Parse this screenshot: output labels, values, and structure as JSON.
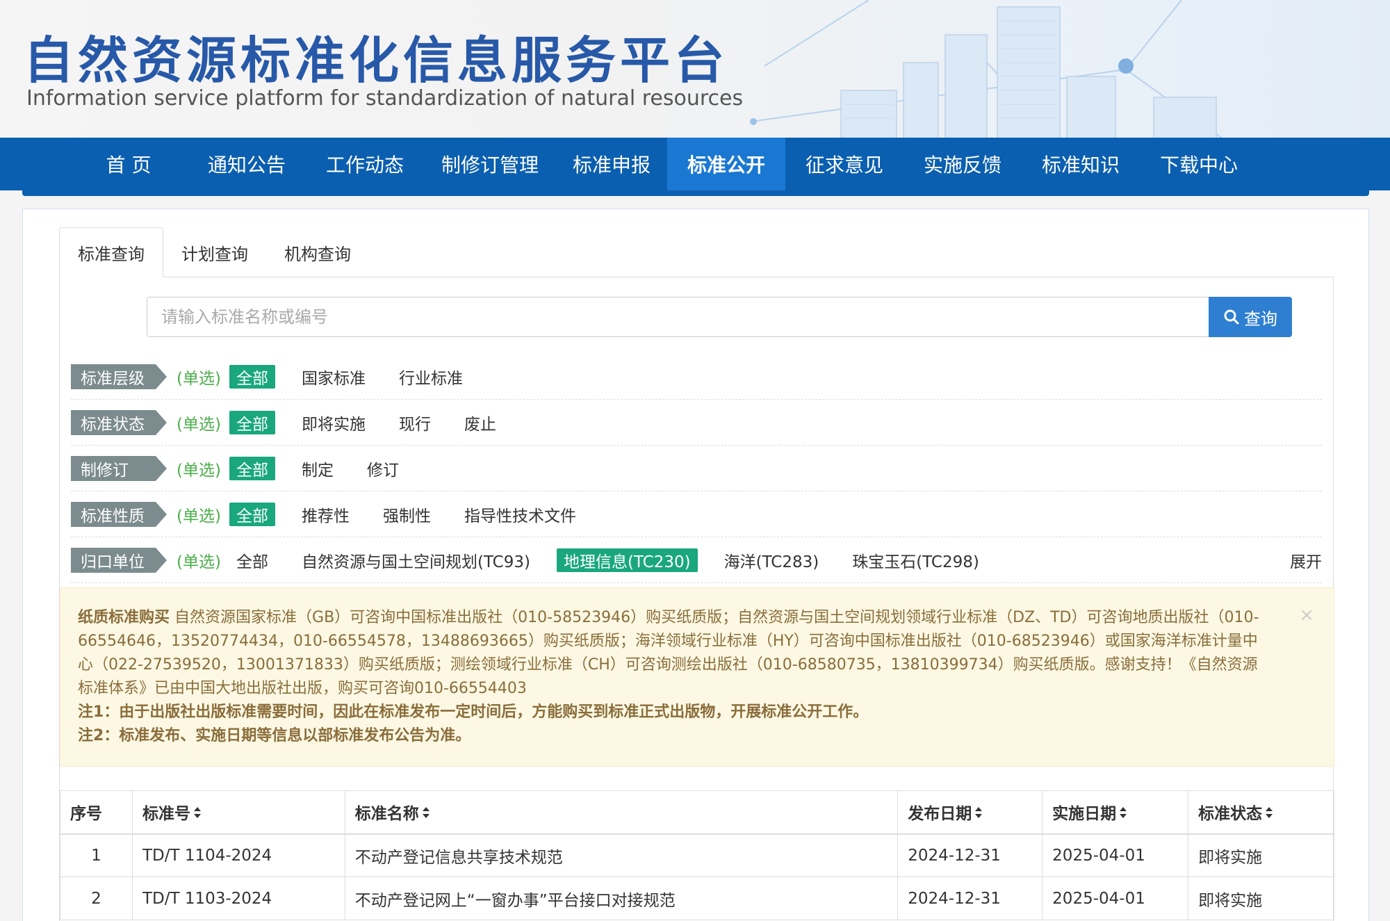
{
  "header": {
    "title": "自然资源标准化信息服务平台",
    "subtitle": "Information service platform for standardization of natural resources"
  },
  "nav": [
    {
      "label": "首 页"
    },
    {
      "label": "通知公告"
    },
    {
      "label": "工作动态"
    },
    {
      "label": "制修订管理"
    },
    {
      "label": "标准申报"
    },
    {
      "label": "标准公开",
      "active": true
    },
    {
      "label": "征求意见"
    },
    {
      "label": "实施反馈"
    },
    {
      "label": "标准知识"
    },
    {
      "label": "下载中心"
    }
  ],
  "tabs": [
    {
      "label": "标准查询",
      "active": true
    },
    {
      "label": "计划查询"
    },
    {
      "label": "机构查询"
    }
  ],
  "search": {
    "placeholder": "请输入标准名称或编号",
    "button_label": "查询",
    "button_icon": "search-icon"
  },
  "filters": [
    {
      "label": "标准层级",
      "mode": "(单选)",
      "options": [
        "全部",
        "国家标准",
        "行业标准"
      ],
      "selected": 0
    },
    {
      "label": "标准状态",
      "mode": "(单选)",
      "options": [
        "全部",
        "即将实施",
        "现行",
        "废止"
      ],
      "selected": 0
    },
    {
      "label": "制修订",
      "mode": "(单选)",
      "options": [
        "全部",
        "制定",
        "修订"
      ],
      "selected": 0
    },
    {
      "label": "标准性质",
      "mode": "(单选)",
      "options": [
        "全部",
        "推荐性",
        "强制性",
        "指导性技术文件"
      ],
      "selected": 0
    },
    {
      "label": "归口单位",
      "mode": "(单选)",
      "options": [
        "全部",
        "自然资源与国土空间规划(TC93)",
        "地理信息(TC230)",
        "海洋(TC283)",
        "珠宝玉石(TC298)"
      ],
      "selected": 2,
      "expand_label": "展开"
    }
  ],
  "notice": {
    "heading": "纸质标准购买",
    "body": "自然资源国家标准（GB）可咨询中国标准出版社（010-58523946）购买纸质版；自然资源与国土空间规划领域行业标准（DZ、TD）可咨询地质出版社（010-66554646，13520774434，010-66554578，13488693665）购买纸质版；海洋领域行业标准（HY）可咨询中国标准出版社（010-68523946）或国家海洋标准计量中心（022-27539520，13001371833）购买纸质版；测绘领域行业标准（CH）可咨询测绘出版社（010-68580735，13810399734）购买纸质版。感谢支持！《自然资源标准体系》已由中国大地出版社出版，购买可咨询010-66554403",
    "note1": "注1：由于出版社出版标准需要时间，因此在标准发布一定时间后，方能购买到标准正式出版物，开展标准公开工作。",
    "note2": "注2：标准发布、实施日期等信息以部标准发布公告为准。",
    "close": "×"
  },
  "table": {
    "columns": [
      {
        "label": "序号",
        "sortable": false
      },
      {
        "label": "标准号",
        "sortable": true
      },
      {
        "label": "标准名称",
        "sortable": true
      },
      {
        "label": "发布日期",
        "sortable": true
      },
      {
        "label": "实施日期",
        "sortable": true
      },
      {
        "label": "标准状态",
        "sortable": true
      }
    ],
    "sort_icon": "sort-icon",
    "rows": [
      [
        "1",
        "TD/T 1104-2024",
        "不动产登记信息共享技术规范",
        "2024-12-31",
        "2025-04-01",
        "即将实施"
      ],
      [
        "2",
        "TD/T 1103-2024",
        "不动产登记网上“一窗办事”平台接口对接规范",
        "2024-12-31",
        "2025-04-01",
        "即将实施"
      ]
    ]
  }
}
